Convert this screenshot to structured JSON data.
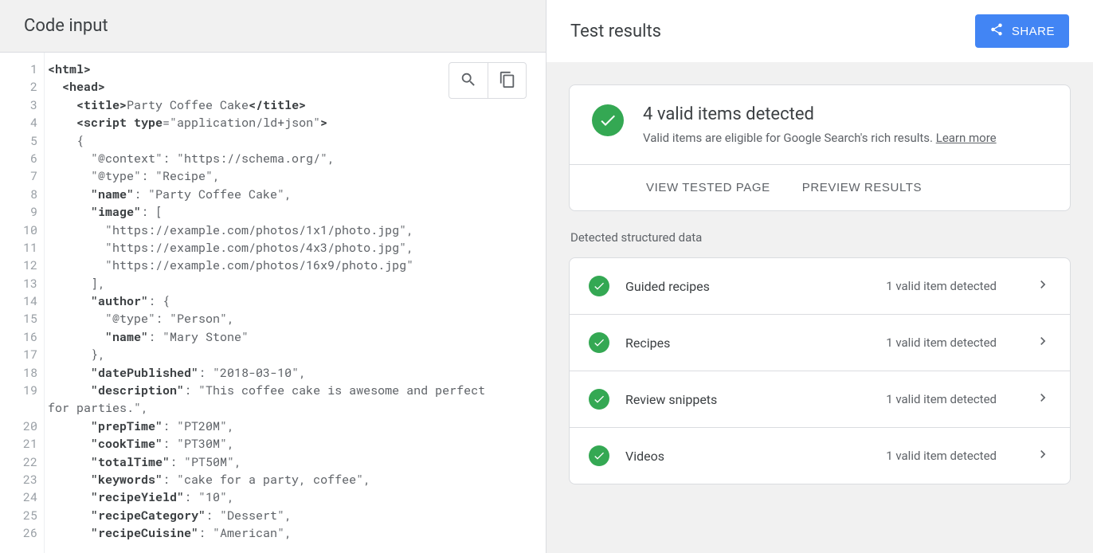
{
  "left": {
    "title": "Code input",
    "lines": [
      {
        "n": 1,
        "segs": [
          {
            "b": 1,
            "t": "<html>"
          }
        ]
      },
      {
        "n": 2,
        "segs": [
          {
            "t": "  "
          },
          {
            "b": 1,
            "t": "<head>"
          }
        ]
      },
      {
        "n": 3,
        "segs": [
          {
            "t": "    "
          },
          {
            "b": 1,
            "t": "<title>"
          },
          {
            "t": "Party Coffee Cake"
          },
          {
            "b": 1,
            "t": "</title>"
          }
        ]
      },
      {
        "n": 4,
        "segs": [
          {
            "t": "    "
          },
          {
            "b": 1,
            "t": "<script type"
          },
          {
            "t": "=\"application/ld+json\""
          },
          {
            "b": 1,
            "t": ">"
          }
        ]
      },
      {
        "n": 5,
        "segs": [
          {
            "t": "    {"
          }
        ]
      },
      {
        "n": 6,
        "segs": [
          {
            "t": "      \"@context\": \"https://schema.org/\","
          }
        ]
      },
      {
        "n": 7,
        "segs": [
          {
            "t": "      \"@type\": \"Recipe\","
          }
        ]
      },
      {
        "n": 8,
        "segs": [
          {
            "t": "      "
          },
          {
            "b": 1,
            "t": "\"name\""
          },
          {
            "t": ": \"Party Coffee Cake\","
          }
        ]
      },
      {
        "n": 9,
        "segs": [
          {
            "t": "      "
          },
          {
            "b": 1,
            "t": "\"image\""
          },
          {
            "t": ": ["
          }
        ]
      },
      {
        "n": 10,
        "segs": [
          {
            "t": "        \"https://example.com/photos/1x1/photo.jpg\","
          }
        ]
      },
      {
        "n": 11,
        "segs": [
          {
            "t": "        \"https://example.com/photos/4x3/photo.jpg\","
          }
        ]
      },
      {
        "n": 12,
        "segs": [
          {
            "t": "        \"https://example.com/photos/16x9/photo.jpg\""
          }
        ]
      },
      {
        "n": 13,
        "segs": [
          {
            "t": "      ],"
          }
        ]
      },
      {
        "n": 14,
        "segs": [
          {
            "t": "      "
          },
          {
            "b": 1,
            "t": "\"author\""
          },
          {
            "t": ": {"
          }
        ]
      },
      {
        "n": 15,
        "segs": [
          {
            "t": "        \"@type\": \"Person\","
          }
        ]
      },
      {
        "n": 16,
        "segs": [
          {
            "t": "        "
          },
          {
            "b": 1,
            "t": "\"name\""
          },
          {
            "t": ": \"Mary Stone\""
          }
        ]
      },
      {
        "n": 17,
        "segs": [
          {
            "t": "      },"
          }
        ]
      },
      {
        "n": 18,
        "segs": [
          {
            "t": "      "
          },
          {
            "b": 1,
            "t": "\"datePublished\""
          },
          {
            "t": ": \"2018-03-10\","
          }
        ]
      },
      {
        "n": 19,
        "segs": [
          {
            "t": "      "
          },
          {
            "b": 1,
            "t": "\"description\""
          },
          {
            "t": ": \"This coffee cake is awesome and perfect"
          }
        ]
      },
      {
        "n": 0,
        "segs": [
          {
            "t": "for parties.\","
          }
        ]
      },
      {
        "n": 20,
        "segs": [
          {
            "t": "      "
          },
          {
            "b": 1,
            "t": "\"prepTime\""
          },
          {
            "t": ": \"PT20M\","
          }
        ]
      },
      {
        "n": 21,
        "segs": [
          {
            "t": "      "
          },
          {
            "b": 1,
            "t": "\"cookTime\""
          },
          {
            "t": ": \"PT30M\","
          }
        ]
      },
      {
        "n": 22,
        "segs": [
          {
            "t": "      "
          },
          {
            "b": 1,
            "t": "\"totalTime\""
          },
          {
            "t": ": \"PT50M\","
          }
        ]
      },
      {
        "n": 23,
        "segs": [
          {
            "t": "      "
          },
          {
            "b": 1,
            "t": "\"keywords\""
          },
          {
            "t": ": \"cake for a party, coffee\","
          }
        ]
      },
      {
        "n": 24,
        "segs": [
          {
            "t": "      "
          },
          {
            "b": 1,
            "t": "\"recipeYield\""
          },
          {
            "t": ": \"10\","
          }
        ]
      },
      {
        "n": 25,
        "segs": [
          {
            "t": "      "
          },
          {
            "b": 1,
            "t": "\"recipeCategory\""
          },
          {
            "t": ": \"Dessert\","
          }
        ]
      },
      {
        "n": 26,
        "segs": [
          {
            "t": "      "
          },
          {
            "b": 1,
            "t": "\"recipeCuisine\""
          },
          {
            "t": ": \"American\","
          }
        ]
      }
    ]
  },
  "right": {
    "title": "Test results",
    "share": "SHARE",
    "summary": {
      "heading": "4 valid items detected",
      "subtext": "Valid items are eligible for Google Search's rich results. ",
      "link": "Learn more",
      "actions": {
        "view": "VIEW TESTED PAGE",
        "preview": "PREVIEW RESULTS"
      }
    },
    "detected_label": "Detected structured data",
    "items": [
      {
        "name": "Guided recipes",
        "status": "1 valid item detected"
      },
      {
        "name": "Recipes",
        "status": "1 valid item detected"
      },
      {
        "name": "Review snippets",
        "status": "1 valid item detected"
      },
      {
        "name": "Videos",
        "status": "1 valid item detected"
      }
    ]
  }
}
